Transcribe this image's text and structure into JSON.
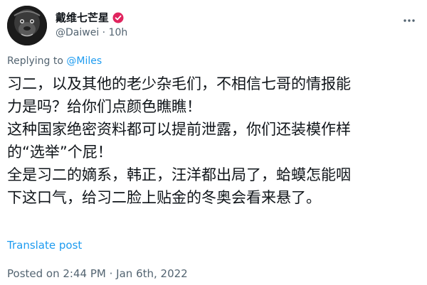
{
  "author": {
    "display_name": "戴维七芒星",
    "handle": "@Daiwei",
    "separator": "·",
    "time_ago": "10h"
  },
  "reply": {
    "prefix": "Replying to ",
    "target": "@Miles"
  },
  "tweet": {
    "lines": [
      "习二，以及其他的老少杂毛们，不相信七哥的情报能",
      "力是吗？给你们点颜色瞧瞧！",
      "这种国家绝密资料都可以提前泄露，你们还装模作样",
      "的“选举”个屁！",
      "全是习二的嫡系，韩正，汪洋都出局了，蛤蟆怎能咽",
      "下这口气，给习二脸上贴金的冬奥会看来悬了。"
    ]
  },
  "translate_label": "Translate post",
  "posted": {
    "label": "Posted on",
    "time": "2:44 PM",
    "separator": "·",
    "date": "Jan 6th, 2022"
  },
  "colors": {
    "link": "#1d9bf0",
    "muted": "#536471",
    "verified_badge": "#e0245e"
  },
  "icons": {
    "avatar": "gorilla-avatar",
    "verified": "verified-badge-icon",
    "more": "more-options-icon"
  }
}
